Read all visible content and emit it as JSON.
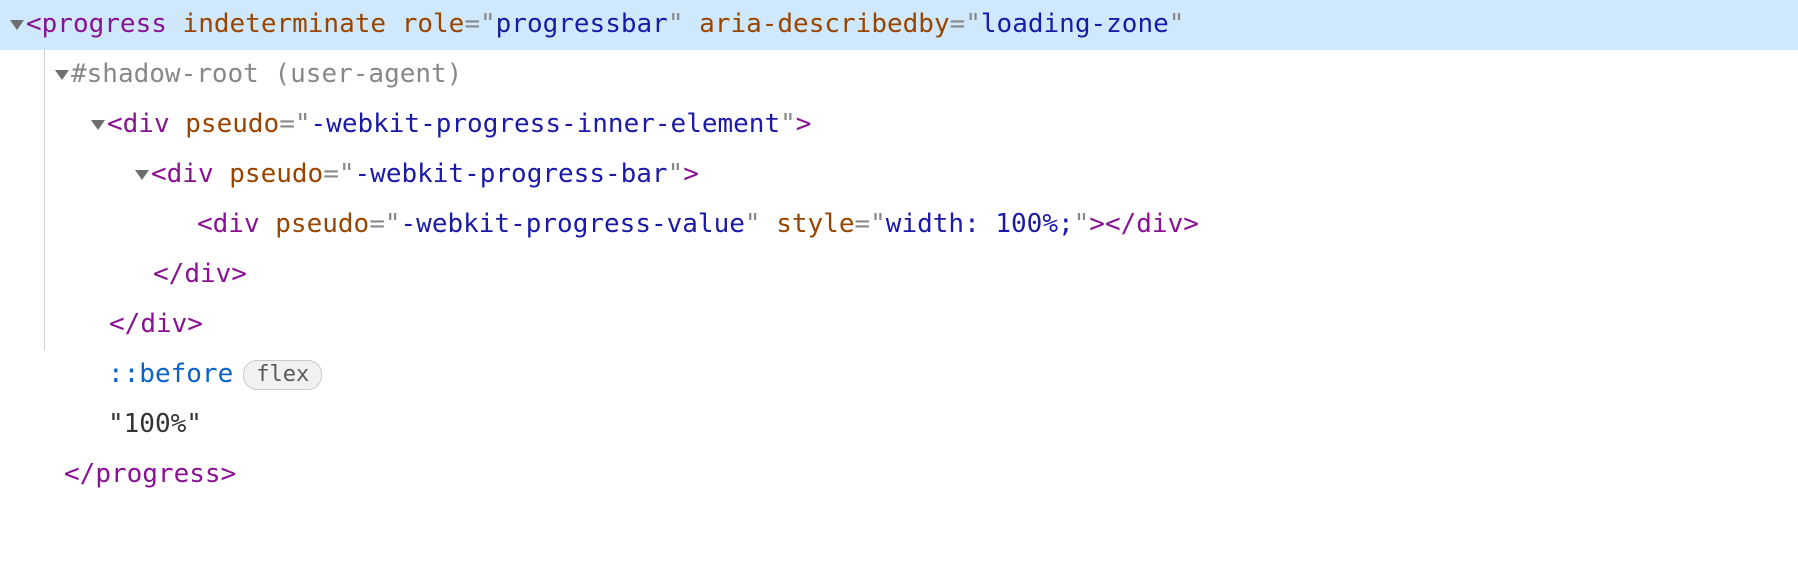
{
  "lines": {
    "l1": {
      "tag": "progress",
      "attrs": [
        {
          "name": "indeterminate",
          "value": null
        },
        {
          "name": "role",
          "value": "progressbar"
        },
        {
          "name": "aria-describedby",
          "value": "loading-zone"
        }
      ]
    },
    "l2": {
      "text": "#shadow-root (user-agent)"
    },
    "l3": {
      "tag": "div",
      "attrs": [
        {
          "name": "pseudo",
          "value": "-webkit-progress-inner-element"
        }
      ]
    },
    "l4": {
      "tag": "div",
      "attrs": [
        {
          "name": "pseudo",
          "value": "-webkit-progress-bar"
        }
      ]
    },
    "l5": {
      "tag": "div",
      "attrs": [
        {
          "name": "pseudo",
          "value": "-webkit-progress-value"
        },
        {
          "name": "style",
          "value": "width: 100%;"
        }
      ],
      "closeTag": "div"
    },
    "l6": {
      "closeTag": "div"
    },
    "l7": {
      "closeTag": "div"
    },
    "l8": {
      "pseudo": "::before",
      "badge": "flex"
    },
    "l9": {
      "quotedText": "100%"
    },
    "l10": {
      "closeTag": "progress"
    }
  },
  "glyphs": {
    "open": "<",
    "close": ">",
    "slash": "/",
    "eq": "=",
    "quote": "\""
  }
}
